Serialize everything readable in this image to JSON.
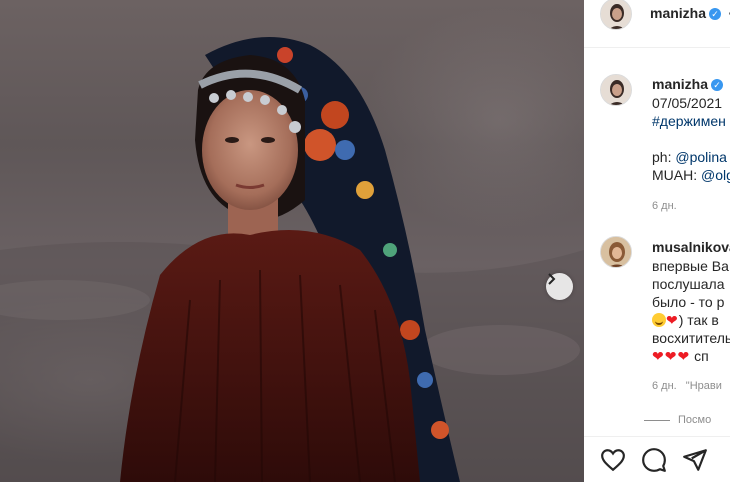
{
  "header": {
    "username": "manizha",
    "verified_mark": "✓",
    "more_text": "•"
  },
  "caption": {
    "username": "manizha",
    "date": "07/05/2021",
    "hashtag": "#держимен",
    "photo_credit_label": "ph:",
    "photo_credit_handle": "@polina",
    "muah_label": "MUAH:",
    "muah_handle": "@olg",
    "age": "6 дн."
  },
  "comment": {
    "username": "musalnikova",
    "lines": [
      "впервые Ва",
      "послушала",
      "было - то р",
      ") так в",
      "восхитительн",
      "сп"
    ],
    "hearts_2": "❤",
    "hearts_3": "❤❤❤",
    "age": "6 дн.",
    "reply_preview": "\"Нрави"
  },
  "view_replies": "Посмо",
  "actions": {
    "like_icon": "heart-outline-icon",
    "comment_icon": "speech-bubble-icon",
    "share_icon": "paper-plane-icon"
  },
  "colors": {
    "link": "#00376b",
    "verified": "#3897f0",
    "heart": "#ed1c24",
    "muted": "#8e8e8e"
  }
}
